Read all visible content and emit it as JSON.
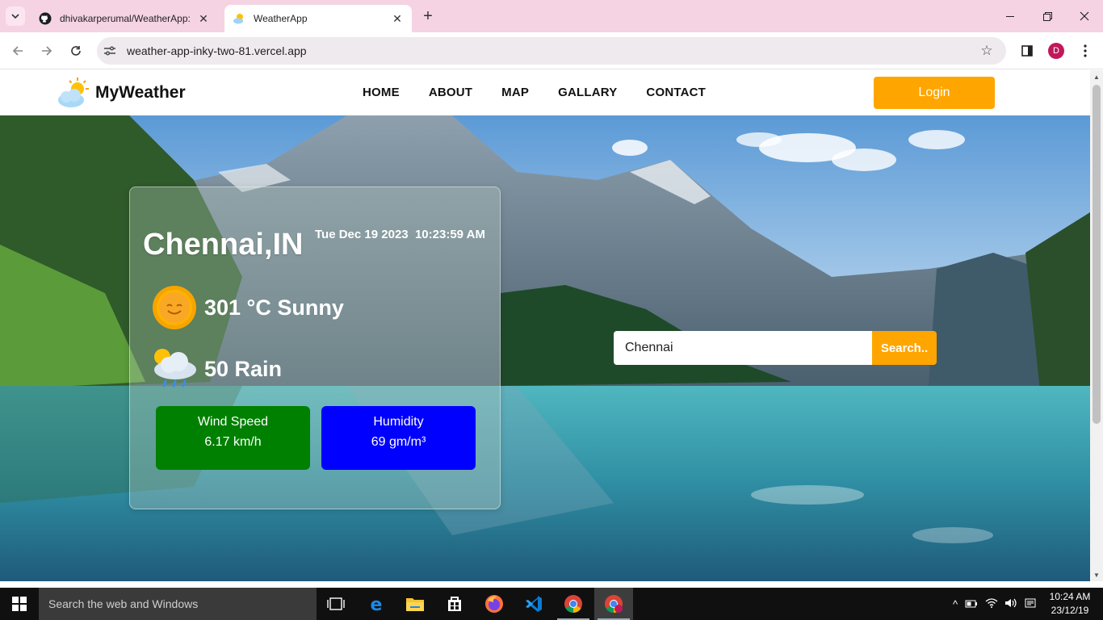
{
  "browser": {
    "tabs": [
      {
        "title": "dhivakarperumal/WeatherApp: ",
        "favicon": "github-icon",
        "active": false
      },
      {
        "title": "WeatherApp",
        "favicon": "weather-favicon-icon",
        "active": true
      }
    ],
    "url": "weather-app-inky-two-81.vercel.app",
    "profile_initial": "D"
  },
  "site": {
    "brand": "MyWeather",
    "menu": [
      "HOME",
      "ABOUT",
      "MAP",
      "GALLARY",
      "CONTACT"
    ],
    "login_label": "Login"
  },
  "weather": {
    "city": "Chennai,IN",
    "datetime": "Tue Dec 19 2023  10:23:59 AM",
    "temperature": "301 °C Sunny",
    "rain": "50 Rain",
    "wind_label": "Wind Speed",
    "wind_value": "6.17 km/h",
    "humidity_label": "Humidity",
    "humidity_value": "69 gm/m³"
  },
  "search": {
    "value": "Chennai",
    "button_label": "Search.."
  },
  "colors": {
    "accent": "#ffa500",
    "wind_box": "#008000",
    "humidity_box": "#0000ff",
    "tab_strip": "#f5d3e3"
  },
  "taskbar": {
    "search_placeholder": "Search the web and Windows",
    "time": "10:24 AM",
    "date": "23/12/19"
  }
}
